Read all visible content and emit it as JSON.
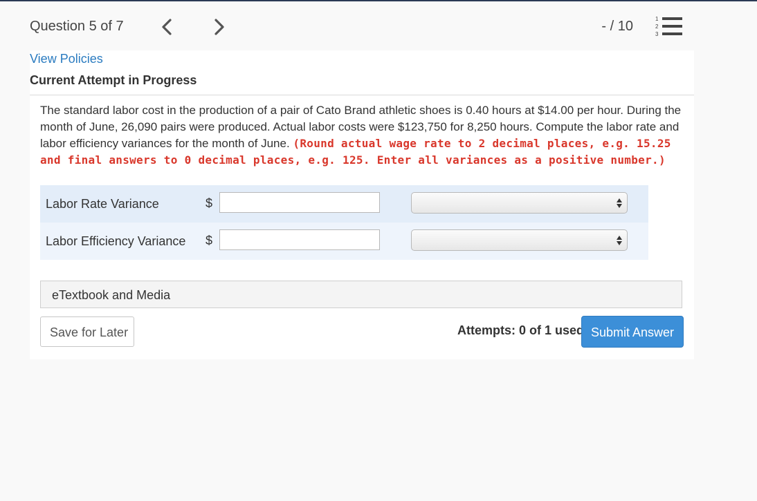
{
  "header": {
    "question_counter": "Question 5 of 7",
    "score": "- / 10",
    "list_icon_digits": [
      "1",
      "2",
      "3"
    ]
  },
  "links": {
    "view_policies": "View Policies"
  },
  "attempt": {
    "title": "Current Attempt in Progress"
  },
  "problem": {
    "text": "The standard labor cost in the production of a pair of Cato Brand athletic shoes is 0.40 hours at $14.00 per hour. During the month of June, 26,090 pairs were produced. Actual labor costs were $123,750 for 8,250 hours. Compute the labor rate and labor efficiency variances for the month of June.",
    "instruction": "(Round actual wage rate to 2 decimal places, e.g. 15.25 and final answers to 0 decimal places, e.g. 125. Enter all variances as a positive number.)"
  },
  "rows": [
    {
      "label": "Labor Rate Variance",
      "currency": "$",
      "value": "",
      "selection": ""
    },
    {
      "label": "Labor Efficiency Variance",
      "currency": "$",
      "value": "",
      "selection": ""
    }
  ],
  "etextbook": {
    "label": "eTextbook and Media"
  },
  "footer": {
    "save_label": "Save for Later",
    "attempts": "Attempts: 0 of 1 used",
    "submit_label": "Submit Answer"
  },
  "colors": {
    "link": "#2a7bc0",
    "instruction": "#d9372b",
    "submit": "#3c8fd8",
    "row1_bg": "#e3edf9",
    "row2_bg": "#eef4fc"
  },
  "icons": {
    "prev": "chevron-left-icon",
    "next": "chevron-right-icon",
    "list": "numbered-list-icon",
    "select": "updown-arrows-icon"
  }
}
